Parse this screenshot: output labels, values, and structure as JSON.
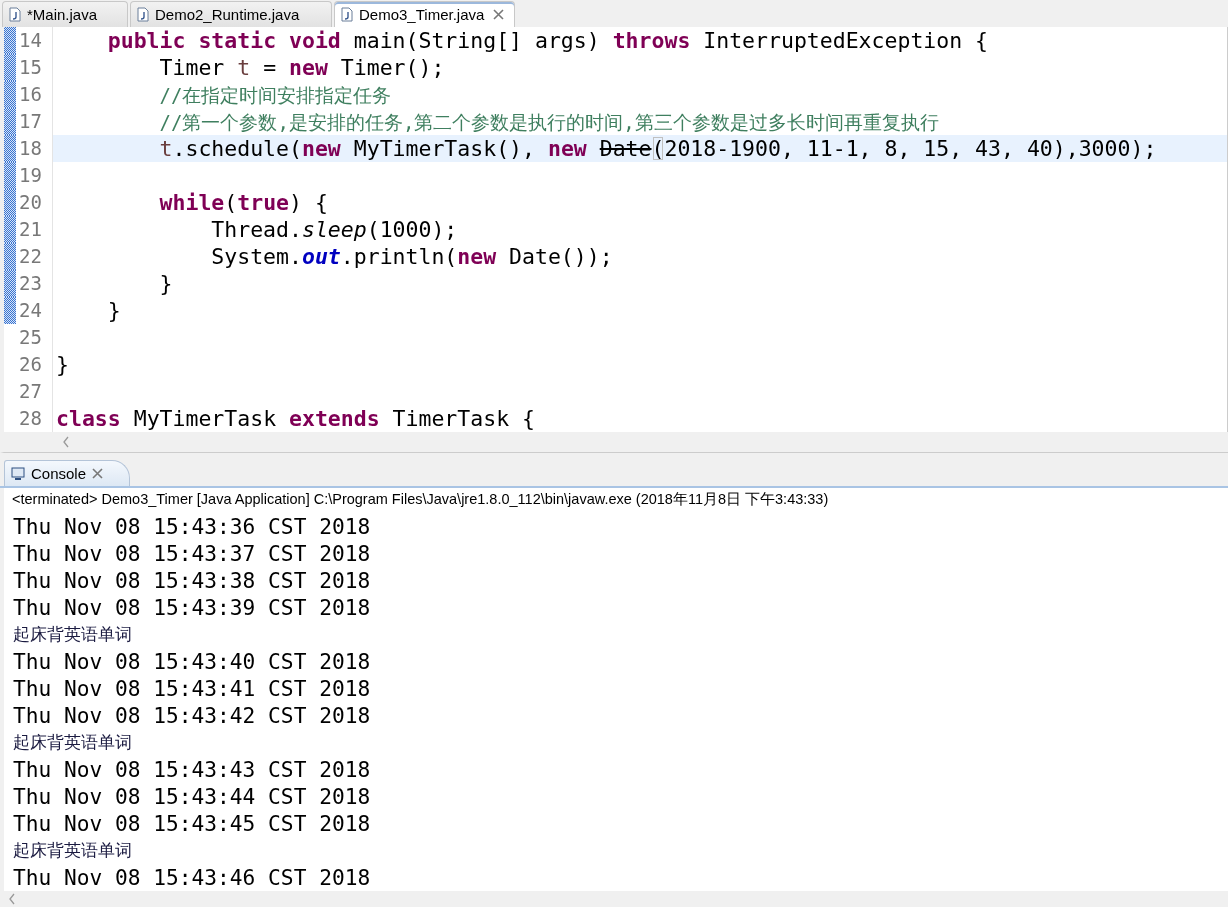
{
  "editor_tabs": [
    {
      "label": "*Main.java",
      "selected": false,
      "closable": false
    },
    {
      "label": "Demo2_Runtime.java",
      "selected": false,
      "closable": false
    },
    {
      "label": "Demo3_Timer.java",
      "selected": true,
      "closable": true
    }
  ],
  "code_lines": [
    {
      "number": "14",
      "current": false,
      "in_range": true,
      "tokens": [
        {
          "kind": "keyword",
          "text": "    public"
        },
        {
          "kind": "keyword",
          "text": " static"
        },
        {
          "kind": "keyword",
          "text": " void"
        },
        {
          "kind": "plain",
          "text": " main(String[] args) "
        },
        {
          "kind": "keyword",
          "text": "throws"
        },
        {
          "kind": "plain",
          "text": " InterruptedException {"
        }
      ]
    },
    {
      "number": "15",
      "current": false,
      "in_range": true,
      "tokens": [
        {
          "kind": "plain",
          "text": "        Timer "
        },
        {
          "kind": "local",
          "text": "t"
        },
        {
          "kind": "plain",
          "text": " = "
        },
        {
          "kind": "keyword",
          "text": "new"
        },
        {
          "kind": "plain",
          "text": " Timer();"
        }
      ]
    },
    {
      "number": "16",
      "current": false,
      "in_range": true,
      "tokens": [
        {
          "kind": "comment",
          "text": "        //在指定时间安排指定任务"
        }
      ]
    },
    {
      "number": "17",
      "current": false,
      "in_range": true,
      "tokens": [
        {
          "kind": "comment",
          "text": "        //第一个参数,是安排的任务,第二个参数是执行的时间,第三个参数是过多长时间再重复执行"
        }
      ]
    },
    {
      "number": "18",
      "current": true,
      "in_range": true,
      "tokens": [
        {
          "kind": "local",
          "text": "        t"
        },
        {
          "kind": "plain",
          "text": ".schedule("
        },
        {
          "kind": "keyword",
          "text": "new"
        },
        {
          "kind": "plain",
          "text": " MyTimerTask(), "
        },
        {
          "kind": "keyword",
          "text": "new "
        },
        {
          "kind": "deprecated",
          "text": "Date"
        },
        {
          "kind": "bracket",
          "text": "("
        },
        {
          "kind": "plain",
          "text": "2018-1900, 11-1, 8, 15, 43, 40),3000);"
        }
      ]
    },
    {
      "number": "19",
      "current": false,
      "in_range": true
    },
    {
      "number": "20",
      "current": false,
      "in_range": true,
      "tokens": [
        {
          "kind": "keyword",
          "text": "        while"
        },
        {
          "kind": "plain",
          "text": "("
        },
        {
          "kind": "keyword",
          "text": "true"
        },
        {
          "kind": "plain",
          "text": ") {"
        }
      ]
    },
    {
      "number": "21",
      "current": false,
      "in_range": true,
      "tokens": [
        {
          "kind": "plain",
          "text": "            Thread."
        },
        {
          "kind": "static-method",
          "text": "sleep"
        },
        {
          "kind": "plain",
          "text": "(1000);"
        }
      ]
    },
    {
      "number": "22",
      "current": false,
      "in_range": true,
      "tokens": [
        {
          "kind": "plain",
          "text": "            System."
        },
        {
          "kind": "static-field",
          "text": "out"
        },
        {
          "kind": "plain",
          "text": ".println("
        },
        {
          "kind": "keyword",
          "text": "new"
        },
        {
          "kind": "plain",
          "text": " Date());"
        }
      ]
    },
    {
      "number": "23",
      "current": false,
      "in_range": true,
      "tokens": [
        {
          "kind": "plain",
          "text": "        }"
        }
      ]
    },
    {
      "number": "24",
      "current": false,
      "in_range": true,
      "tokens": [
        {
          "kind": "plain",
          "text": "    }"
        }
      ]
    },
    {
      "number": "25",
      "current": false,
      "in_range": false
    },
    {
      "number": "26",
      "current": false,
      "in_range": false,
      "tokens": [
        {
          "kind": "plain",
          "text": "}"
        }
      ]
    },
    {
      "number": "27",
      "current": false,
      "in_range": false
    },
    {
      "number": "28",
      "current": false,
      "in_range": false,
      "tokens": [
        {
          "kind": "keyword",
          "text": "class"
        },
        {
          "kind": "plain",
          "text": " MyTimerTask "
        },
        {
          "kind": "keyword",
          "text": "extends"
        },
        {
          "kind": "plain",
          "text": " TimerTask {"
        }
      ]
    }
  ],
  "console": {
    "tab": {
      "label": "Console",
      "selected": true
    },
    "status": "<terminated> Demo3_Timer [Java Application] C:\\Program Files\\Java\\jre1.8.0_112\\bin\\javaw.exe (2018年11月8日 下午3:43:33)",
    "output": [
      {
        "kind": "date",
        "text": "Thu Nov 08 15:43:36 CST 2018"
      },
      {
        "kind": "date",
        "text": "Thu Nov 08 15:43:37 CST 2018"
      },
      {
        "kind": "date",
        "text": "Thu Nov 08 15:43:38 CST 2018"
      },
      {
        "kind": "date",
        "text": "Thu Nov 08 15:43:39 CST 2018"
      },
      {
        "kind": "message",
        "text": "起床背英语单词"
      },
      {
        "kind": "date",
        "text": "Thu Nov 08 15:43:40 CST 2018"
      },
      {
        "kind": "date",
        "text": "Thu Nov 08 15:43:41 CST 2018"
      },
      {
        "kind": "date",
        "text": "Thu Nov 08 15:43:42 CST 2018"
      },
      {
        "kind": "message",
        "text": "起床背英语单词"
      },
      {
        "kind": "date",
        "text": "Thu Nov 08 15:43:43 CST 2018"
      },
      {
        "kind": "date",
        "text": "Thu Nov 08 15:43:44 CST 2018"
      },
      {
        "kind": "date",
        "text": "Thu Nov 08 15:43:45 CST 2018"
      },
      {
        "kind": "message",
        "text": "起床背英语单词"
      },
      {
        "kind": "date",
        "text": "Thu Nov 08 15:43:46 CST 2018"
      }
    ]
  }
}
